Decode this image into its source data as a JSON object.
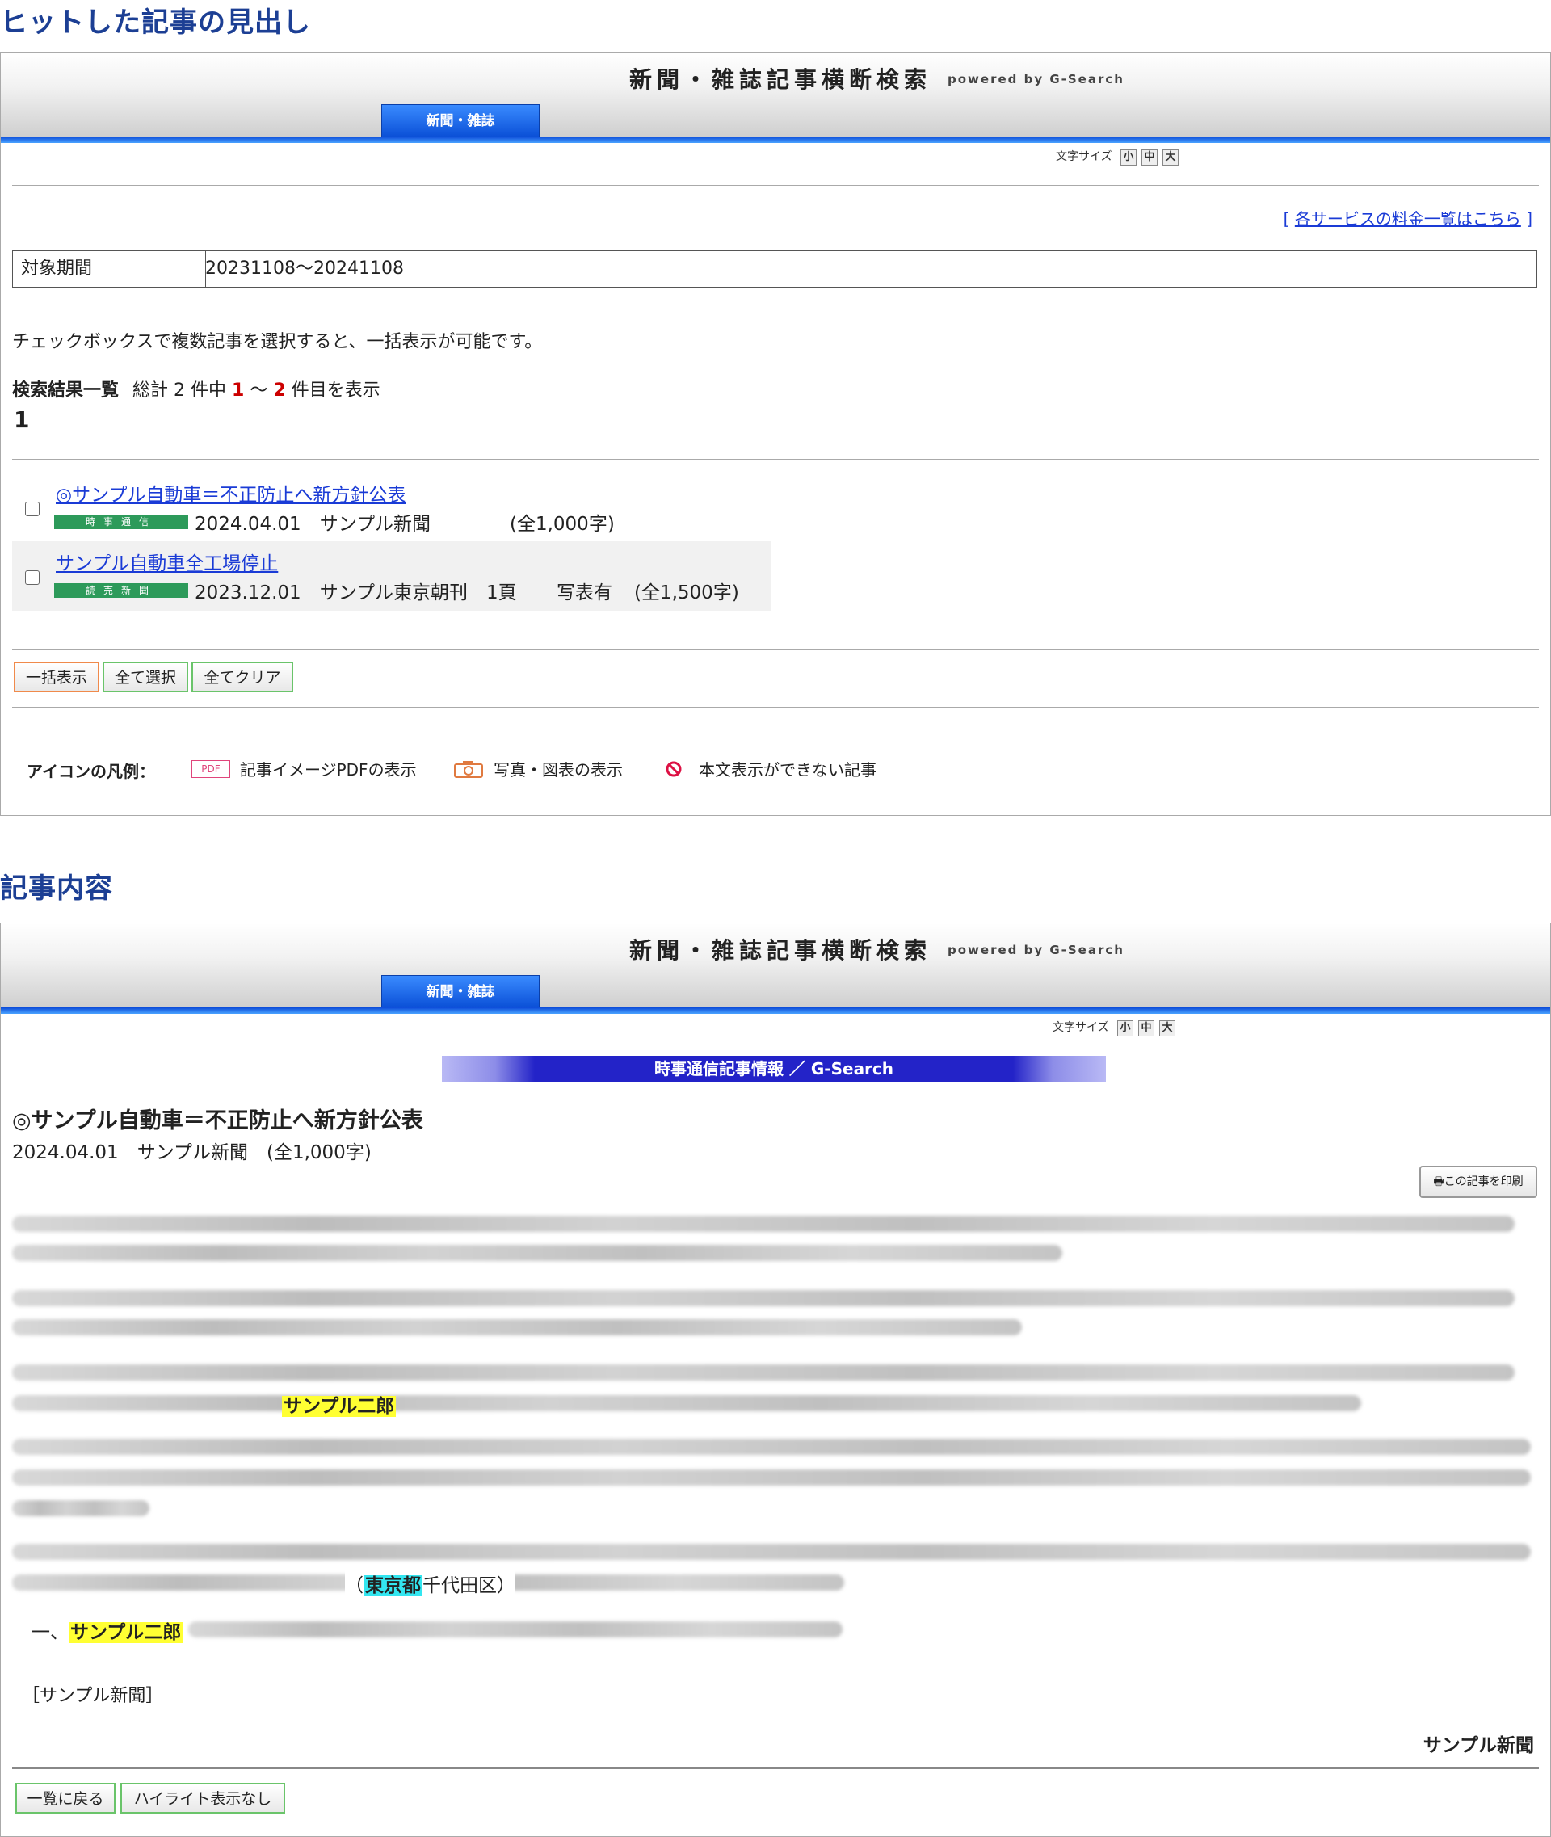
{
  "section1": {
    "title": "ヒットした記事の見出し"
  },
  "section2": {
    "title": "記事内容"
  },
  "header": {
    "title": "新聞・雑誌記事横断検索",
    "powered": "powered by G-Search",
    "tab": "新聞・雑誌",
    "font_size_label": "文字サイズ",
    "font_sizes": [
      "小",
      "中",
      "大"
    ]
  },
  "results": {
    "price_link_open": "[",
    "price_link": "各サービスの料金一覧はこちら",
    "price_link_close": "]",
    "period_label": "対象期間",
    "period_value": "20231108〜20241108",
    "instruction": "チェックボックスで複数記事を選択すると、一括表示が可能です。",
    "summary_label": "検索結果一覧",
    "summary_pre": "総計 2 件中",
    "summary_from": "1",
    "summary_tilde": "〜",
    "summary_to": "2",
    "summary_post": "件目を表示",
    "page": "1",
    "items": [
      {
        "title": "◎サンプル自動車＝不正防止へ新方針公表",
        "source": "時事通信",
        "date": "2024.04.01",
        "paper": "サンプル新聞",
        "page": "",
        "photo": "",
        "length": "(全1,000字)"
      },
      {
        "title": "サンプル自動車全工場停止",
        "source": "読売新聞",
        "date": "2023.12.01",
        "paper": "サンプル東京朝刊",
        "page": "1頁",
        "photo": "写表有",
        "length": "(全1,500字)"
      }
    ],
    "buttons": {
      "bulk": "一括表示",
      "select_all": "全て選択",
      "clear_all": "全てクリア"
    },
    "legend": {
      "label": "アイコンの凡例：",
      "pdf_badge": "PDF",
      "pdf": "記事イメージPDFの表示",
      "photo": "写真・図表の表示",
      "noview": "本文表示ができない記事"
    }
  },
  "article": {
    "banner": "時事通信記事情報 ／ G-Search",
    "title": "◎サンプル自動車＝不正防止へ新方針公表",
    "meta": "2024.04.01　サンプル新聞　(全1,000字)",
    "print": "この記事を印刷",
    "highlight1": "サンプル二郎",
    "paren_open": "（",
    "highlight2": "東京都",
    "after_highlight2": "千代田区）",
    "item_prefix": "一、",
    "highlight3": "サンプル二郎",
    "source_bracket": "［サンプル新聞］",
    "footer_source": "サンプル新聞",
    "buttons": {
      "back": "一覧に戻る",
      "nohighlight": "ハイライト表示なし"
    }
  },
  "colors": {
    "title_blue": "#1c3f94",
    "link": "#1a3bd6",
    "accent_red": "#cc0000",
    "source_green": "#2d9a5a",
    "highlight_yellow": "#ffff33",
    "highlight_cyan": "#33e6f0"
  }
}
